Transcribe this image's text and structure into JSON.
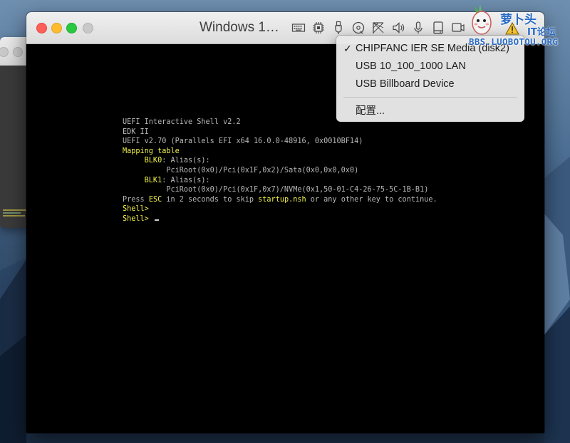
{
  "window": {
    "title": "Windows 1…"
  },
  "toolbar": {
    "icons": [
      "keyboard-icon",
      "cpu-icon",
      "usb-icon",
      "cd-icon",
      "network-icon",
      "sound-icon",
      "microphone-icon",
      "hard-disk-icon",
      "display-icon"
    ]
  },
  "console": {
    "lines": [
      [
        {
          "t": "UEFI Interactive Shell v2.2",
          "c": "n"
        }
      ],
      [
        {
          "t": "EDK II",
          "c": "n"
        }
      ],
      [
        {
          "t": "UEFI v2.70 (Parallels EFI x64 16.0.0-48916, 0x0010BF14)",
          "c": "n"
        }
      ],
      [
        {
          "t": "Mapping table",
          "c": "y"
        }
      ],
      [
        {
          "t": "     BLK0",
          "c": "y"
        },
        {
          "t": ": Alias(s):",
          "c": "n"
        }
      ],
      [
        {
          "t": "          PciRoot(0x0)/Pci(0x1F,0x2)/Sata(0x0,0x0,0x0)",
          "c": "n"
        }
      ],
      [
        {
          "t": "     BLK1",
          "c": "y"
        },
        {
          "t": ": Alias(s):",
          "c": "n"
        }
      ],
      [
        {
          "t": "          PciRoot(0x0)/Pci(0x1F,0x7)/NVMe(0x1,50-01-C4-26-75-5C-1B-B1)",
          "c": "n"
        }
      ],
      [
        {
          "t": "Press ",
          "c": "n"
        },
        {
          "t": "ESC",
          "c": "y"
        },
        {
          "t": " in 2 seconds to skip ",
          "c": "n"
        },
        {
          "t": "startup.nsh",
          "c": "y"
        },
        {
          "t": " or any other key to continue.",
          "c": "n"
        }
      ],
      [
        {
          "t": "Shell>",
          "c": "y"
        }
      ],
      [
        {
          "t": "Shell> ",
          "c": "y"
        }
      ]
    ]
  },
  "menu": {
    "items": [
      {
        "label": "CHIPFANC IER SE Media (disk2)",
        "checked": true
      },
      {
        "label": "USB 10_100_1000 LAN",
        "checked": false
      },
      {
        "label": "USB Billboard Device",
        "checked": false
      }
    ],
    "checkmark": "✓",
    "configure_label": "配置..."
  },
  "watermark": {
    "title": "萝卜头",
    "subtitle": "IT论坛",
    "url": "BBS.LUOBOTOU.ORG"
  },
  "colors": {
    "console_text": "#b7b7b7",
    "console_highlight": "#f2f24a",
    "watermark": "#2a6bc4"
  }
}
